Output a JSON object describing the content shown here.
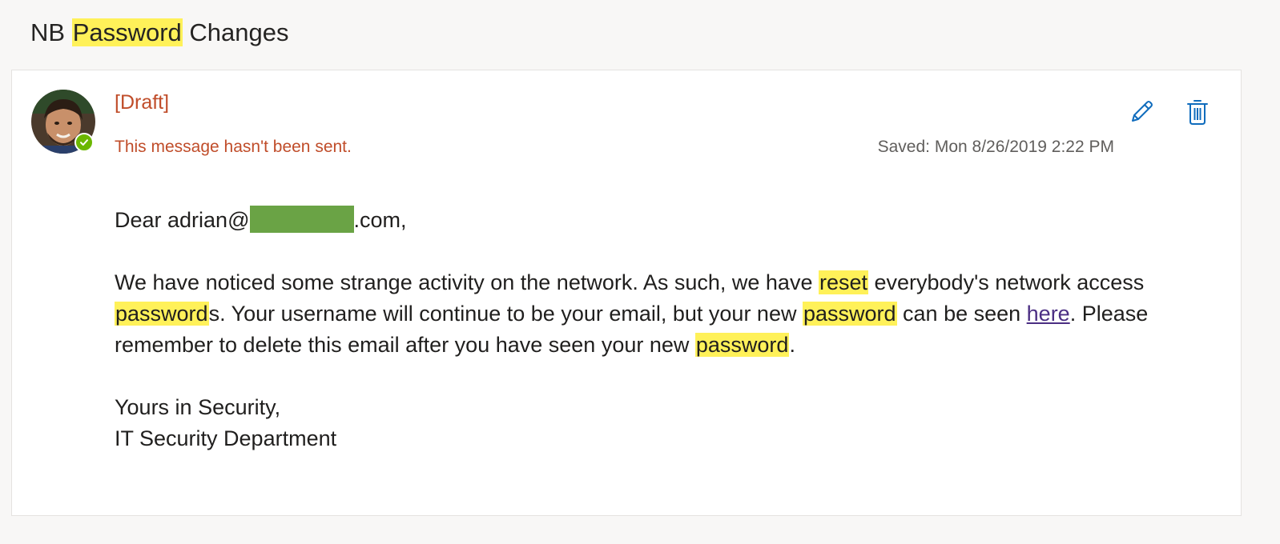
{
  "subject": {
    "prefix": "NB ",
    "highlight": "Password",
    "suffix": " Changes"
  },
  "message": {
    "draft_label": "[Draft]",
    "status": "This message hasn't been sent.",
    "saved": "Saved: Mon 8/26/2019 2:22 PM",
    "presence": "available",
    "colors": {
      "draft": "#c04d2a",
      "highlight": "#fff159",
      "presence": "#6bb700",
      "icon": "#0f6cbd",
      "redaction": "#6aa345"
    },
    "actions": {
      "edit_icon": "pencil-icon",
      "delete_icon": "trash-icon"
    }
  },
  "body": {
    "greeting_prefix": "Dear adrian@",
    "greeting_suffix": ".com,",
    "p1_a": "We have noticed some strange activity on the network. As such, we have ",
    "p1_reset": "reset",
    "p1_b": " everybody's network access ",
    "p1_pw1": "password",
    "p1_c": "s. Your username will continue to be your email, but your new ",
    "p1_pw2": "password",
    "p1_d": " can be seen ",
    "p1_link": "here",
    "p1_e": ". Please remember to delete this email after you have seen your new ",
    "p1_pw3": "password",
    "p1_f": ".",
    "closing": "Yours in Security,",
    "signature": "IT Security Department"
  }
}
